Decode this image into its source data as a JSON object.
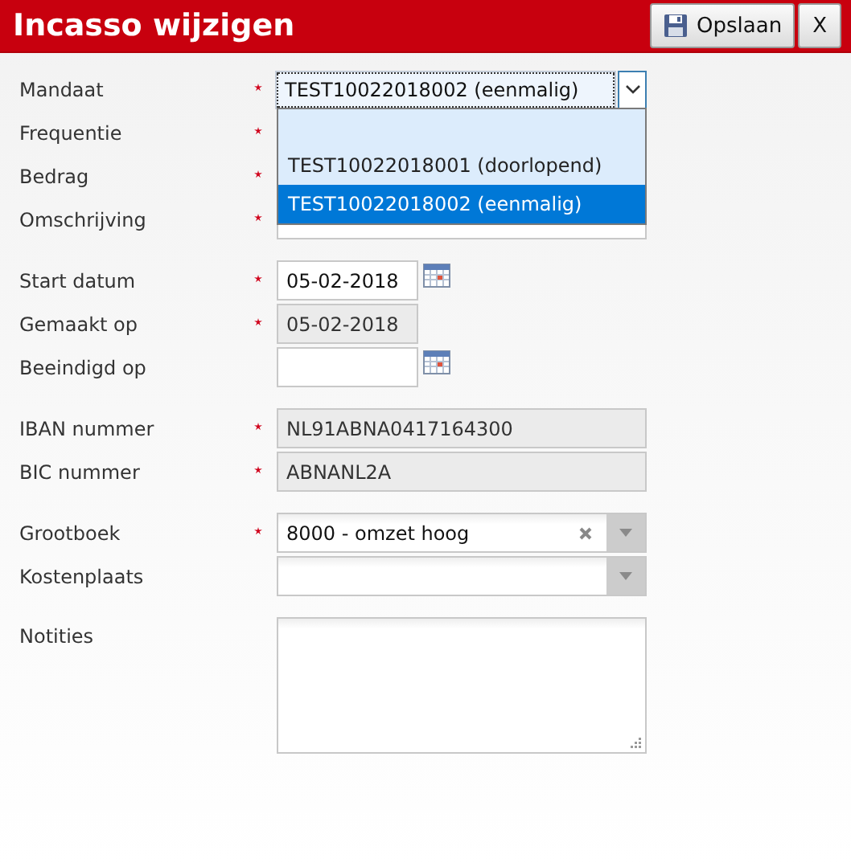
{
  "window": {
    "title": "Incasso wijzigen"
  },
  "toolbar": {
    "buttons": [
      {
        "kind": "save",
        "label": "Opslaan"
      },
      {
        "kind": "close",
        "label": "X"
      }
    ]
  },
  "sections": [
    {
      "fields": [
        {
          "label": "Mandaat",
          "required": true,
          "kind": "select",
          "value": "TEST10022018002 (eenmalig)",
          "expanded": true,
          "options": [
            {
              "label": "TEST10022018001 (doorlopend)",
              "selected": false
            },
            {
              "label": "TEST10022018002 (eenmalig)",
              "selected": true
            }
          ]
        },
        {
          "label": "Frequentie",
          "required": true,
          "kind": "covered"
        },
        {
          "label": "Bedrag",
          "required": true,
          "kind": "covered"
        },
        {
          "label": "Omschrijving",
          "required": true,
          "kind": "text"
        }
      ]
    },
    {
      "fields": [
        {
          "label": "Start datum",
          "required": true,
          "kind": "date",
          "value": "05-02-2018",
          "disabled": false
        },
        {
          "label": "Gemaakt op",
          "required": true,
          "kind": "text-short",
          "value": "05-02-2018",
          "disabled": true
        },
        {
          "label": "Beeindigd op",
          "required": false,
          "kind": "date",
          "disabled": false
        }
      ]
    },
    {
      "fields": [
        {
          "label": "IBAN nummer",
          "required": true,
          "kind": "text",
          "value": "NL91ABNA0417164300",
          "disabled": true
        },
        {
          "label": "BIC nummer",
          "required": true,
          "kind": "text",
          "value": "ABNANL2A",
          "disabled": true
        }
      ]
    },
    {
      "fields": [
        {
          "label": "Grootboek",
          "required": true,
          "kind": "combo",
          "value": "8000 - omzet hoog"
        },
        {
          "label": "Kostenplaats",
          "required": false,
          "kind": "combo"
        }
      ]
    },
    {
      "fields": [
        {
          "label": "Notities",
          "required": false,
          "kind": "textarea"
        }
      ]
    }
  ]
}
